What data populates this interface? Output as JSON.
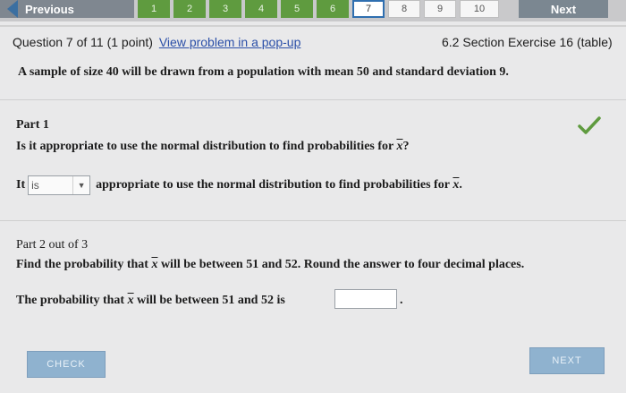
{
  "nav": {
    "previous_label": "Previous",
    "next_label": "Next",
    "question_numbers": [
      "1",
      "2",
      "3",
      "4",
      "5",
      "6",
      "7",
      "8",
      "9",
      "10"
    ]
  },
  "header": {
    "question_info": "Question 7 of 11 (1 point)",
    "popup_link": "View problem in a pop-up",
    "section_ref": "6.2 Section Exercise 16 (table)"
  },
  "problem": {
    "statement": "A sample of size 40 will be drawn from a population with mean 50 and standard deviation 9."
  },
  "part1": {
    "title": "Part 1",
    "question_prefix": "Is it appropriate to use the normal distribution to find probabilities for",
    "x_symbol": "x",
    "question_suffix": "?",
    "answer_prefix": "It",
    "selected_value": "is",
    "answer_suffix": "appropriate to use the normal distribution to find probabilities for",
    "answer_end": "."
  },
  "part2": {
    "title": "Part 2 out of 3",
    "instruction_a": "Find the probability that",
    "instruction_b": "will be between 51 and 52. Round the answer to four decimal places.",
    "answer_a": "The probability that",
    "answer_b": "will be between 51 and 52 is",
    "answer_end": "."
  },
  "buttons": {
    "check_label": "CHECK",
    "next_label": "NEXT"
  },
  "colors": {
    "accent": "#2b4fa8",
    "success": "#5f9b3f"
  }
}
